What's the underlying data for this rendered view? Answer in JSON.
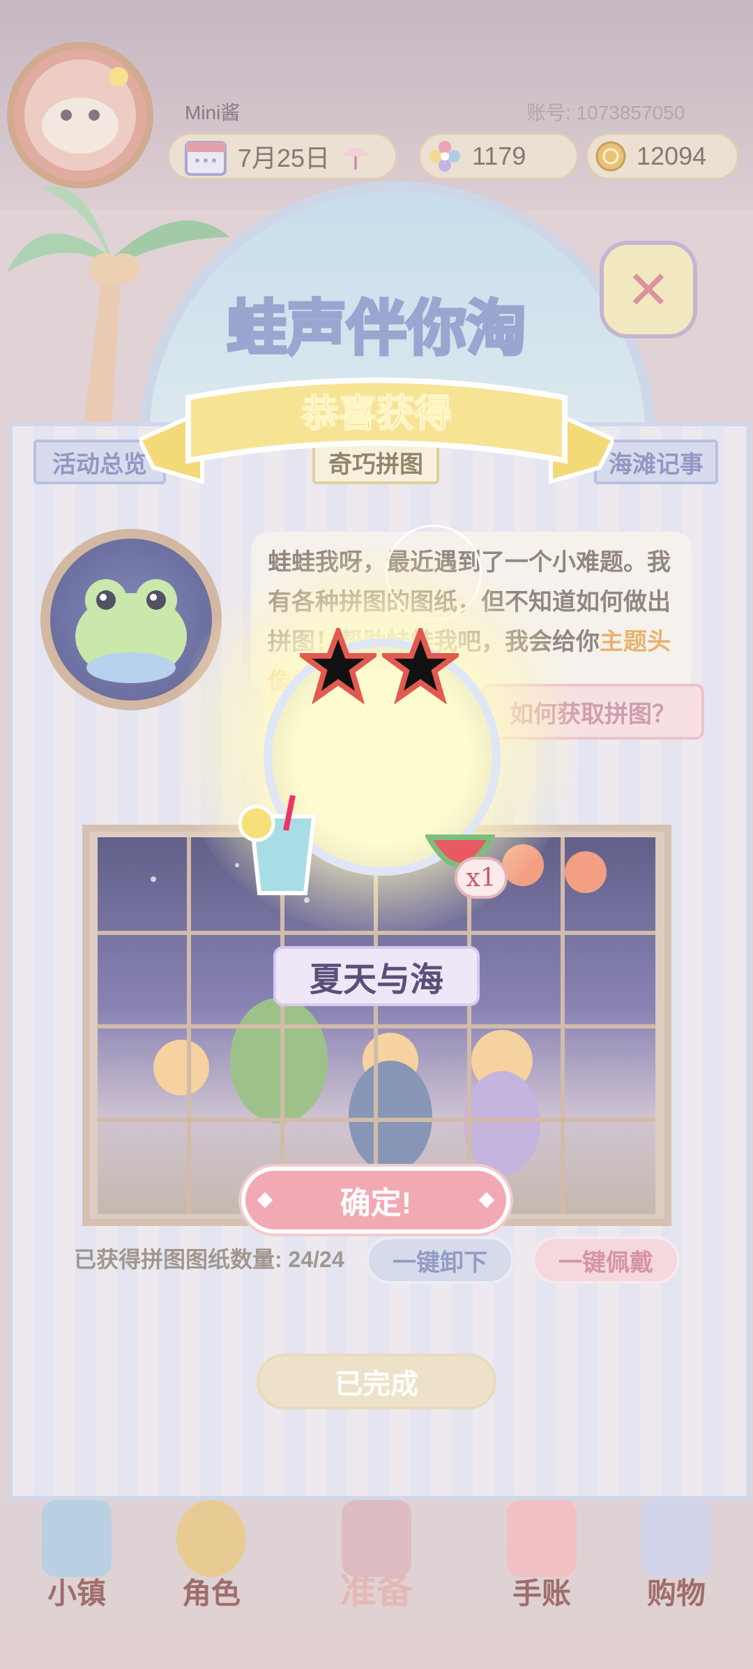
{
  "header": {
    "user_name": "Mini酱",
    "account": "账号: 1073857050",
    "date": "7月25日",
    "gems": "1179",
    "coins": "12094"
  },
  "event": {
    "title": "蛙声伴你淘",
    "tabs": [
      "活动总览",
      "奇巧拼图",
      "海滩记事"
    ],
    "active_tab": "奇巧拼图"
  },
  "puzzle": {
    "dialog_before": "蛙蛙我呀，最近遇到了一个小难题。我有各种拼图的图纸，但不知道如何做出拼图！帮助蛙蛙我吧，我会给你",
    "dialog_highlight": "主题头像框",
    "dialog_after": "作为",
    "how_to_button": "如何获取拼图？",
    "count_label": "已获得拼图图纸数量: 24/24",
    "unequip_button": "一键卸下",
    "equip_button": "一键佩戴",
    "done_button": "已完成"
  },
  "reward_popup": {
    "title": "恭喜获得",
    "quantity": "x1",
    "item_name": "夏天与海",
    "confirm_button": "确定!"
  },
  "bottom_nav": {
    "items": [
      {
        "label": "小镇"
      },
      {
        "label": "角色"
      },
      {
        "label": "准备"
      },
      {
        "label": "手账"
      },
      {
        "label": "购物"
      }
    ]
  },
  "colors": {
    "accent_pink": "#f1aab4",
    "tab_blue": "#cfd4ea",
    "ribbon_gold": "#f3d978"
  }
}
